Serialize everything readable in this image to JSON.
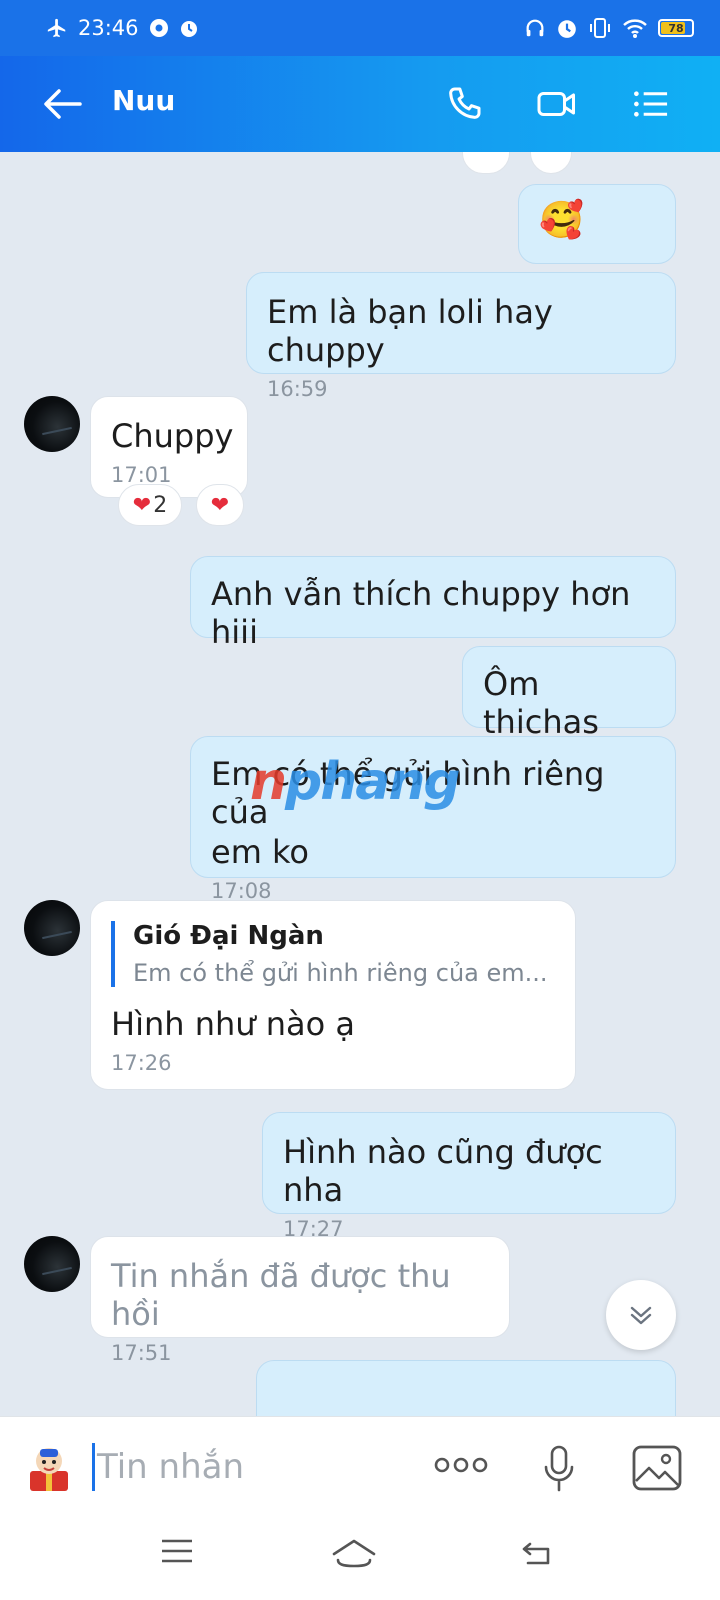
{
  "status_bar": {
    "time": "23:46",
    "battery": "78"
  },
  "header": {
    "title": "Nuu"
  },
  "messages": {
    "m1_emoji": "🥰",
    "m2_text": "Em là bạn loli hay chuppy",
    "m2_time": "16:59",
    "m3_text": "Chuppy",
    "m3_time": "17:01",
    "m3_reaction_count": "2",
    "m4_text": "Anh vẫn thích chuppy hơn hiii",
    "m5_text": "Ôm thichas",
    "m6_text_line1": "Em có thể gửi hình riêng của",
    "m6_text_line2": "em ko",
    "m6_time": "17:08",
    "m7_reply_name": "Gió Đại Ngàn",
    "m7_reply_text": "Em có thể gửi hình riêng của em...",
    "m7_text": "Hình như nào ạ",
    "m7_time": "17:26",
    "m8_text": "Hình nào cũng được nha",
    "m8_time": "17:27",
    "m9_text": "Tin nhắn đã được thu hồi",
    "m9_time": "17:51"
  },
  "watermark": {
    "part1": "n",
    "part2": "phang"
  },
  "input": {
    "placeholder": "Tin nhắn"
  },
  "colors": {
    "accent": "#1a72e8",
    "sent_bubble": "#d6eefc",
    "recv_bubble": "#ffffff",
    "chat_bg": "#e2e9f1"
  }
}
